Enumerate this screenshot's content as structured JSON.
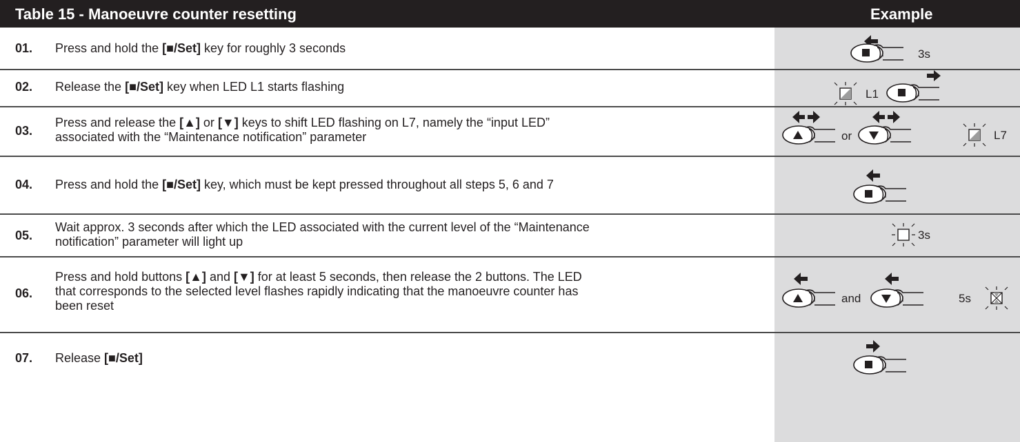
{
  "header": {
    "title": "Table 15 - Manoeuvre counter resetting",
    "example": "Example"
  },
  "rows": [
    {
      "num": "01.",
      "parts": [
        "Press and hold the ",
        "[■/Set]",
        " key for roughly 3 seconds"
      ],
      "example": {
        "time": "3s"
      }
    },
    {
      "num": "02.",
      "parts": [
        "Release the ",
        "[■/Set]",
        " key when LED L1 starts flashing"
      ],
      "example": {
        "led": "L1"
      }
    },
    {
      "num": "03.",
      "parts": [
        "Press and release the ",
        "[▲]",
        " or ",
        "[▼]",
        " keys to shift LED flashing on L7, namely the “input LED” associated with the “Maintenance notification” parameter"
      ],
      "example": {
        "conj": "or",
        "led": "L7"
      }
    },
    {
      "num": "04.",
      "parts": [
        "Press and hold the ",
        "[■/Set]",
        " key, which must be kept pressed throughout all steps 5, 6 and 7"
      ],
      "example": {}
    },
    {
      "num": "05.",
      "parts": [
        "Wait approx. 3 seconds after which the LED associated with the current level of the “Maintenance notification” parameter will light up"
      ],
      "example": {
        "time": "3s"
      }
    },
    {
      "num": "06.",
      "parts": [
        "Press and hold buttons ",
        "[▲]",
        " and ",
        "[▼]",
        " for at least 5 seconds, then release the 2 buttons. The LED that corresponds to the selected level flashes rapidly indicating that the manoeuvre counter has been reset"
      ],
      "example": {
        "conj": "and",
        "time": "5s"
      }
    },
    {
      "num": "07.",
      "parts": [
        "Release ",
        "[■/Set]"
      ],
      "example": {}
    }
  ]
}
